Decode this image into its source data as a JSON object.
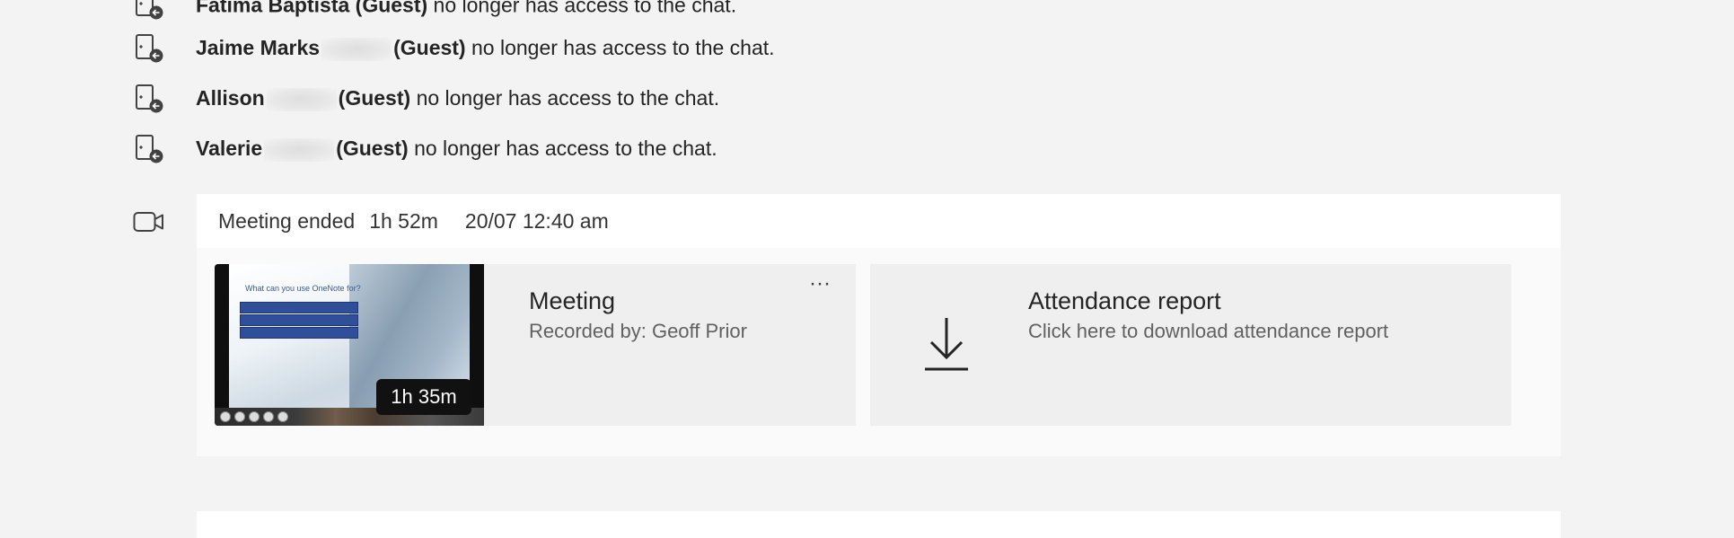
{
  "events": [
    {
      "name": "Fatima Baptista",
      "role": "(Guest)",
      "message": "no longer has access to the chat."
    },
    {
      "name": "Jaime Marks",
      "role": "(Guest)",
      "message": "no longer has access to the chat."
    },
    {
      "name": "Allison",
      "role": "(Guest)",
      "message": "no longer has access to the chat."
    },
    {
      "name": "Valerie",
      "role": "(Guest)",
      "message": "no longer has access to the chat."
    }
  ],
  "meeting": {
    "status": "Meeting ended",
    "length": "1h 52m",
    "datetime": "20/07 12:40 am",
    "recording": {
      "title": "Meeting",
      "recorded_by": "Recorded by: Geoff Prior",
      "duration": "1h 35m",
      "thumbnail_slide_title": "What can you use OneNote for?",
      "more_label": "···"
    },
    "attendance": {
      "title": "Attendance report",
      "subtitle": "Click here to download attendance report"
    }
  },
  "icons": {
    "leave": "person-leave-icon",
    "video": "video-camera-icon",
    "download": "download-icon",
    "more": "more-options-icon"
  }
}
